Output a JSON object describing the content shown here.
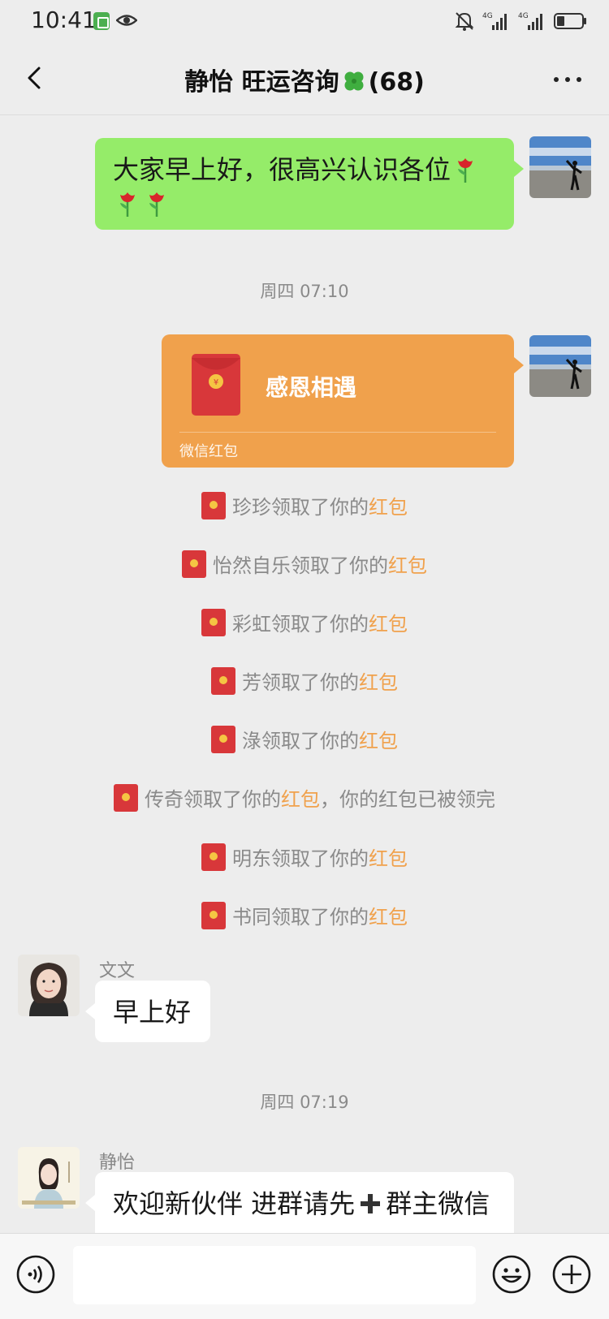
{
  "status_bar": {
    "time": "10:41",
    "network_1": "4G",
    "network_2": "4G"
  },
  "header": {
    "title_part1": "静怡 旺运咨询",
    "title_icon": "four-leaf-clover-icon",
    "title_part2": "(68)"
  },
  "messages": {
    "greeting": {
      "text": "大家早上好，很高兴认识各位",
      "emoji": "rose-icon"
    },
    "time_1": "周四 07:10",
    "red_packet": {
      "title": "感恩相遇",
      "label": "微信红包"
    },
    "claims": [
      {
        "text": "珍珍领取了你的",
        "highlight": "红包",
        "suffix": ""
      },
      {
        "text": "怡然自乐领取了你的",
        "highlight": "红包",
        "suffix": ""
      },
      {
        "text": "彩虹领取了你的",
        "highlight": "红包",
        "suffix": ""
      },
      {
        "text": "芳领取了你的",
        "highlight": "红包",
        "suffix": ""
      },
      {
        "text": "淥领取了你的",
        "highlight": "红包",
        "suffix": ""
      },
      {
        "text": "传奇领取了你的",
        "highlight": "红包",
        "suffix": "，你的红包已被领完"
      },
      {
        "text": "明东领取了你的",
        "highlight": "红包",
        "suffix": ""
      },
      {
        "text": "书同领取了你的",
        "highlight": "红包",
        "suffix": ""
      }
    ],
    "wenwen": {
      "name": "文文",
      "text": "早上好"
    },
    "time_2": "周四 07:19",
    "jingyi": {
      "name": "静怡",
      "text_a": "欢迎新伙伴 进群请先",
      "text_b": "群主微信"
    }
  },
  "colors": {
    "background": "#ededed",
    "self_bubble": "#95ec69",
    "red_packet": "#f0a14c",
    "highlight": "#f0a14c"
  }
}
